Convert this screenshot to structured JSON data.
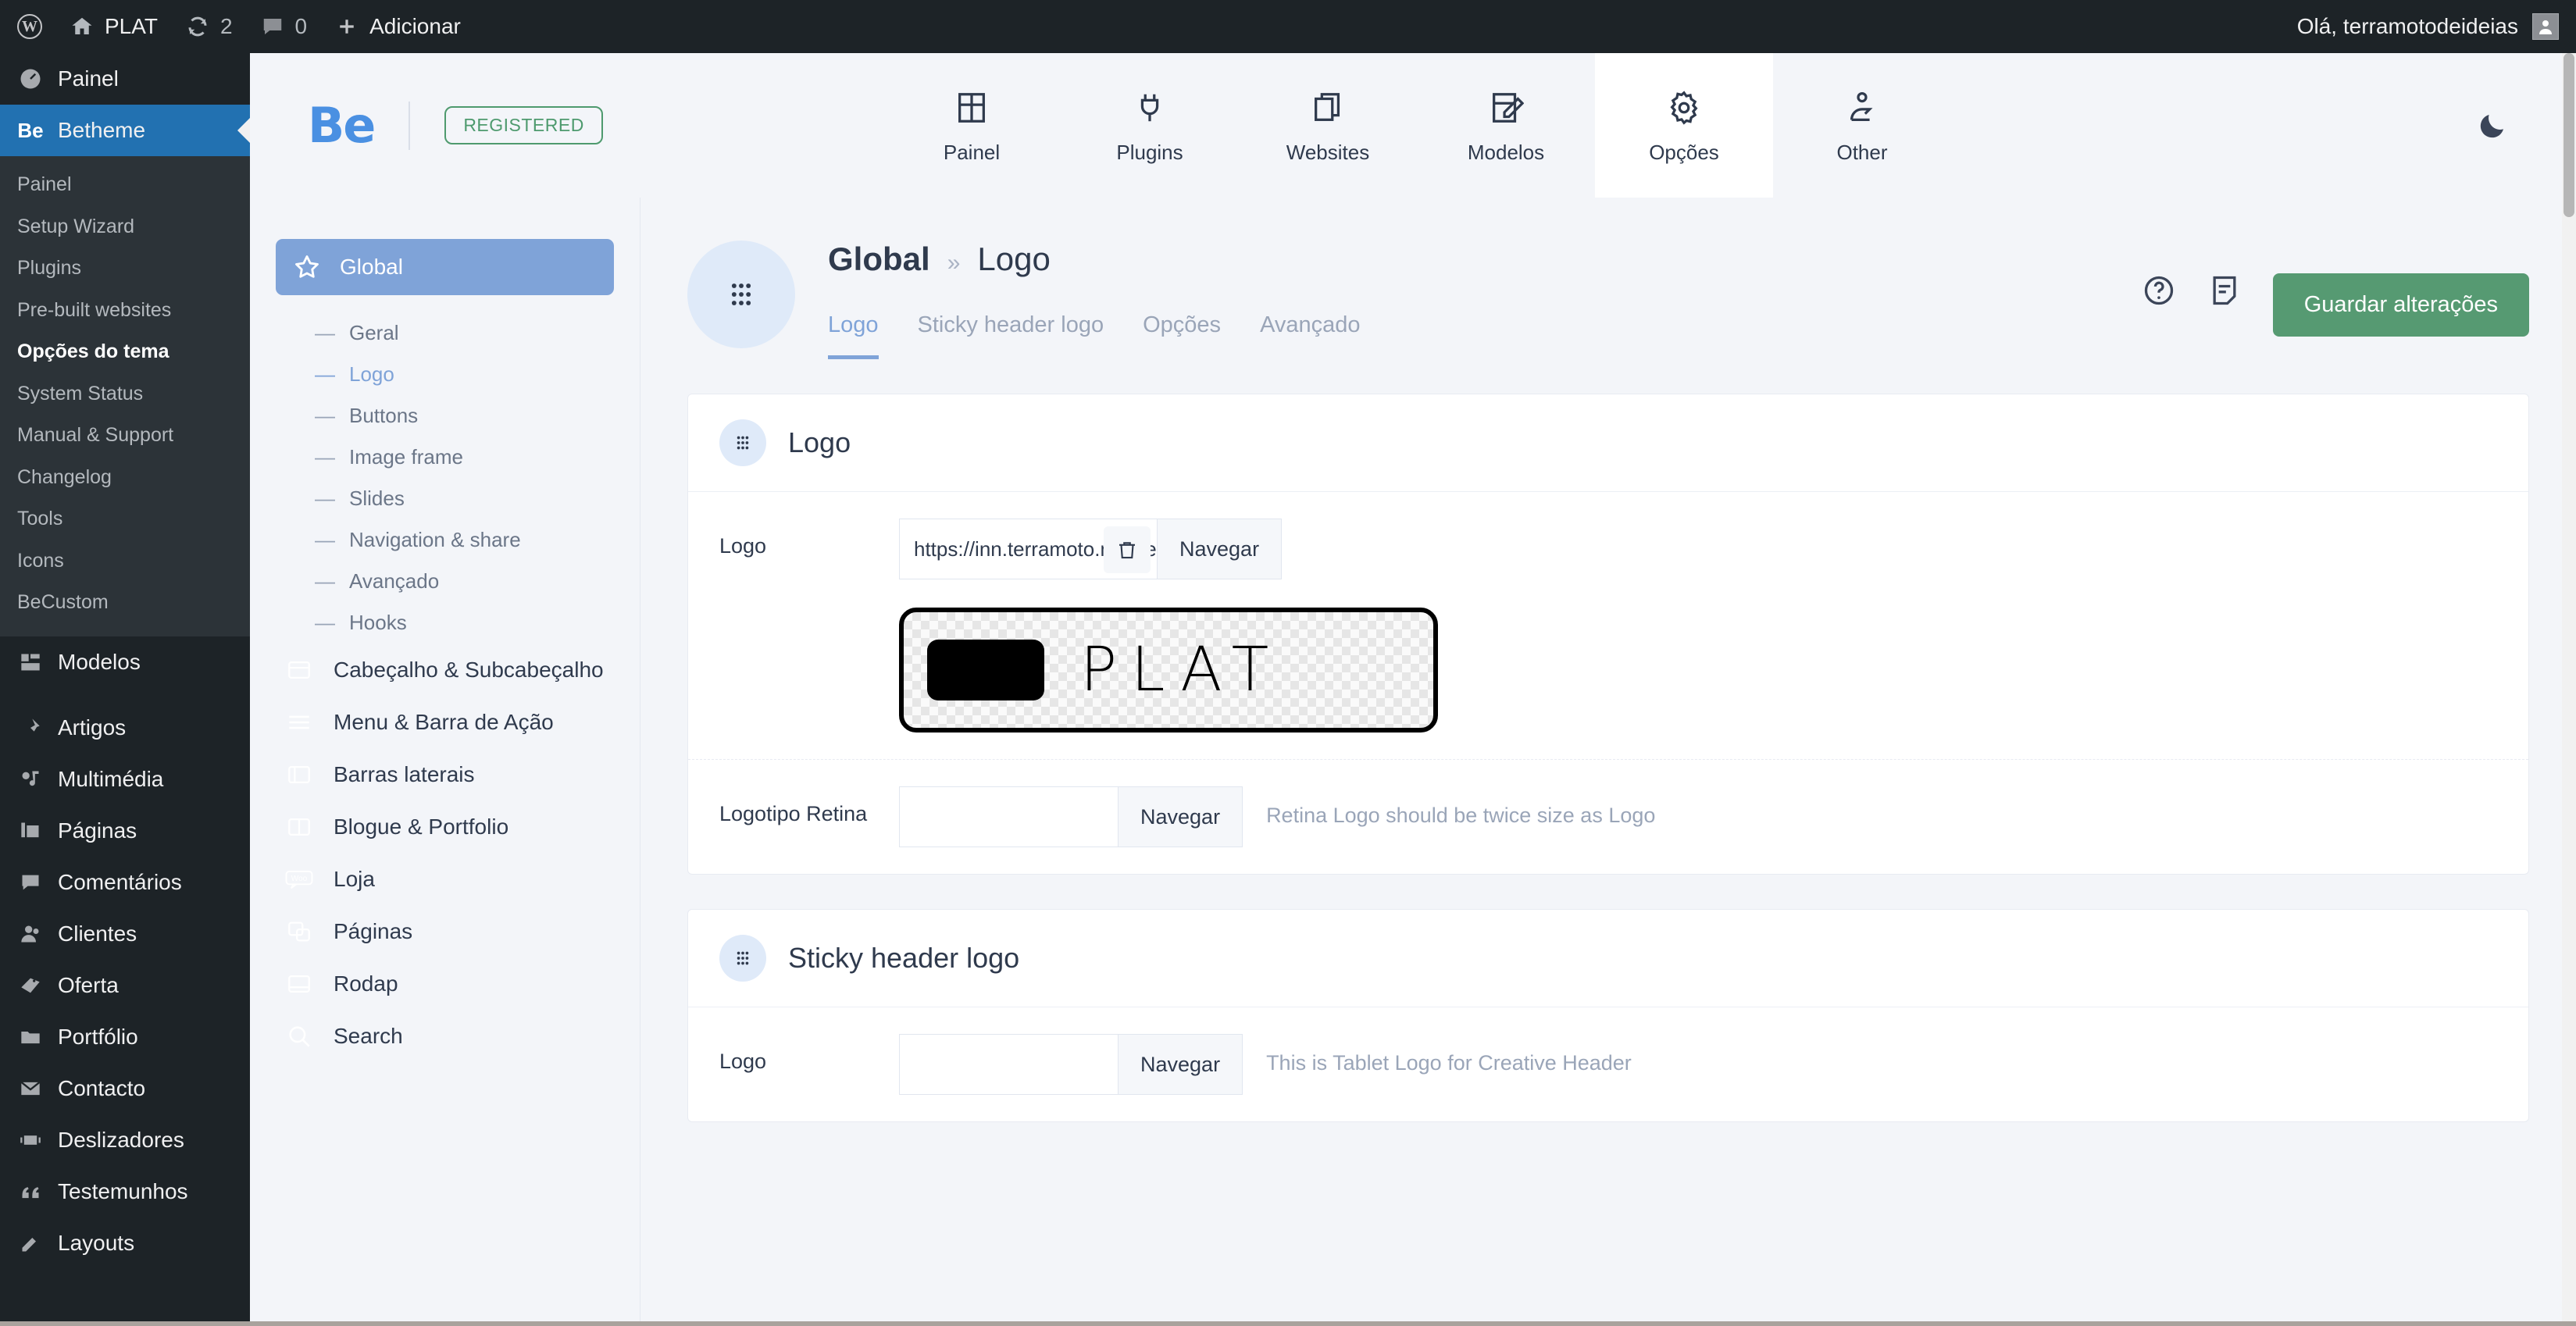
{
  "adminbar": {
    "wp_logo": "wordpress-logo",
    "site_name": "PLAT",
    "updates_count": "2",
    "comments_count": "0",
    "new_label": "Adicionar",
    "greeting": "Olá, terramotodeideias"
  },
  "wp_sidebar": {
    "items": [
      {
        "label": "Painel",
        "icon": "dashboard-icon",
        "current": false
      },
      {
        "label": "Betheme",
        "icon": "be-icon",
        "current": true
      },
      {
        "label": "Modelos",
        "icon": "templates-icon",
        "current": false
      },
      {
        "label": "Artigos",
        "icon": "pin-icon",
        "current": false
      },
      {
        "label": "Multimédia",
        "icon": "media-icon",
        "current": false
      },
      {
        "label": "Páginas",
        "icon": "pages-icon",
        "current": false
      },
      {
        "label": "Comentários",
        "icon": "comments-icon",
        "current": false
      },
      {
        "label": "Clientes",
        "icon": "users-icon",
        "current": false
      },
      {
        "label": "Oferta",
        "icon": "tag-icon",
        "current": false
      },
      {
        "label": "Portfólio",
        "icon": "folder-icon",
        "current": false
      },
      {
        "label": "Contacto",
        "icon": "mail-icon",
        "current": false
      },
      {
        "label": "Deslizadores",
        "icon": "slider-icon",
        "current": false
      },
      {
        "label": "Testemunhos",
        "icon": "quote-icon",
        "current": false
      },
      {
        "label": "Layouts",
        "icon": "pencil-icon",
        "current": false
      }
    ],
    "betheme_submenu": [
      {
        "label": "Painel",
        "current": false
      },
      {
        "label": "Setup Wizard",
        "current": false
      },
      {
        "label": "Plugins",
        "current": false
      },
      {
        "label": "Pre-built websites",
        "current": false
      },
      {
        "label": "Opções do tema",
        "current": true
      },
      {
        "label": "System Status",
        "current": false
      },
      {
        "label": "Manual & Support",
        "current": false
      },
      {
        "label": "Changelog",
        "current": false
      },
      {
        "label": "Tools",
        "current": false
      },
      {
        "label": "Icons",
        "current": false
      },
      {
        "label": "BeCustom",
        "current": false
      }
    ]
  },
  "be_nav": {
    "logo_text": "Be",
    "badge": "REGISTERED",
    "tabs": [
      {
        "label": "Painel",
        "icon": "grid-icon",
        "active": false
      },
      {
        "label": "Plugins",
        "icon": "plug-icon",
        "active": false
      },
      {
        "label": "Websites",
        "icon": "copy-icon",
        "active": false
      },
      {
        "label": "Modelos",
        "icon": "template-edit-icon",
        "active": false
      },
      {
        "label": "Opções",
        "icon": "gear-icon",
        "active": true
      },
      {
        "label": "Other",
        "icon": "hand-heart-icon",
        "active": false
      }
    ],
    "theme_toggle": "moon-icon"
  },
  "options_sidebar": {
    "global": {
      "label": "Global",
      "icon": "star-icon"
    },
    "global_children": [
      {
        "label": "Geral",
        "active": false
      },
      {
        "label": "Logo",
        "active": true
      },
      {
        "label": "Buttons",
        "active": false
      },
      {
        "label": "Image frame",
        "active": false
      },
      {
        "label": "Slides",
        "active": false
      },
      {
        "label": "Navigation & share",
        "active": false
      },
      {
        "label": "Avançado",
        "active": false
      },
      {
        "label": "Hooks",
        "active": false
      }
    ],
    "groups": [
      {
        "label": "Cabeçalho & Subcabeçalho",
        "icon": "header-icon"
      },
      {
        "label": "Menu & Barra de Ação",
        "icon": "menu-icon"
      },
      {
        "label": "Barras laterais",
        "icon": "sidebar-icon"
      },
      {
        "label": "Blogue & Portfolio",
        "icon": "blog-icon"
      },
      {
        "label": "Loja",
        "icon": "woo-icon"
      },
      {
        "label": "Páginas",
        "icon": "pages-stack-icon"
      },
      {
        "label": "Rodap",
        "icon": "footer-icon"
      },
      {
        "label": "Search",
        "icon": "search-icon"
      }
    ]
  },
  "page": {
    "badge_icon": "drag-dots-icon",
    "breadcrumb_root": "Global",
    "breadcrumb_sep": "»",
    "breadcrumb_current": "Logo",
    "tabs": [
      {
        "label": "Logo",
        "active": true
      },
      {
        "label": "Sticky header logo",
        "active": false
      },
      {
        "label": "Opções",
        "active": false
      },
      {
        "label": "Avançado",
        "active": false
      }
    ],
    "help_icon": "help-circle-icon",
    "note_icon": "note-icon",
    "save_label": "Guardar alterações"
  },
  "cards": [
    {
      "title": "Logo",
      "icon": "drag-dots-icon",
      "rows": [
        {
          "label": "Logo",
          "value": "https://inn.terramoto.marketi",
          "placeholder": "",
          "browse_label": "Navegar",
          "has_trash": true,
          "trash_icon": "trash-icon",
          "hint": "",
          "preview": {
            "block": "logo-block",
            "text": "PLAT"
          }
        },
        {
          "label": "Logotipo Retina",
          "value": "",
          "placeholder": "",
          "browse_label": "Navegar",
          "has_trash": false,
          "hint": "Retina Logo should be twice size as Logo",
          "preview": null
        }
      ]
    },
    {
      "title": "Sticky header logo",
      "icon": "drag-dots-icon",
      "rows": [
        {
          "label": "Logo",
          "value": "",
          "placeholder": "",
          "browse_label": "Navegar",
          "has_trash": false,
          "hint": "This is Tablet Logo for Creative Header",
          "preview": null
        }
      ]
    }
  ],
  "colors": {
    "wp_dark": "#1d2327",
    "wp_blue": "#2271b1",
    "be_blue": "#4a90e2",
    "accent_blue": "#7fa3d8",
    "save_green": "#569a72",
    "badge_green": "#4e9a6e",
    "page_bg": "#f3f5f9"
  }
}
